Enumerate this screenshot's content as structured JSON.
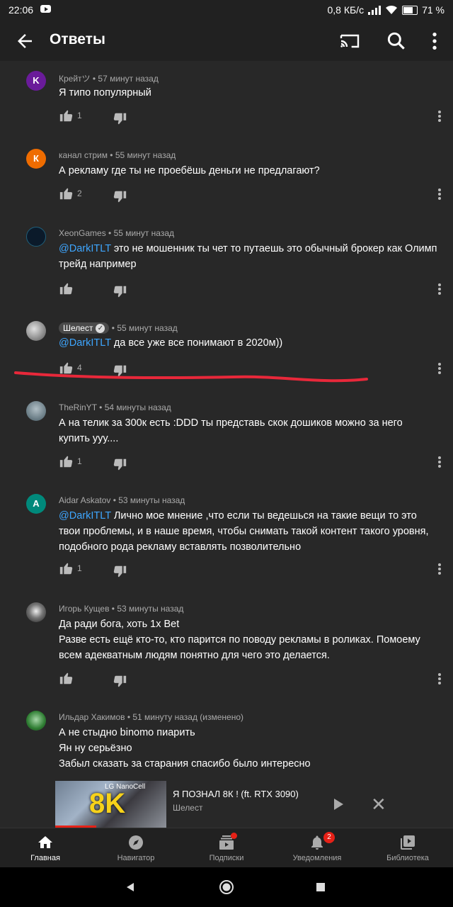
{
  "status_bar": {
    "time": "22:06",
    "net_speed": "0,8 КБ/с",
    "battery": "71 %"
  },
  "app_bar": {
    "title": "Ответы",
    "icons": [
      "back-arrow-icon",
      "cast-icon",
      "search-icon",
      "more-vert-icon"
    ]
  },
  "comments": [
    {
      "author": "Крейтツ",
      "time": "57 минут назад",
      "avatar_letter": "K",
      "avatar_color": "#6a1b9a",
      "lines": [
        "Я типо популярный"
      ],
      "likes": "1"
    },
    {
      "author": "канал стрим",
      "time": "55 минут назад",
      "avatar_letter": "К",
      "avatar_color": "#ef6c00",
      "lines": [
        "А рекламу где ты не проебёшь деньги не предлагают?"
      ],
      "likes": "2"
    },
    {
      "author": "XeonGames",
      "time": "55 минут назад",
      "avatar_color": "#0b1a2a",
      "mention": "@DarkITLT",
      "lines": [
        " это не мошенник ты чет то путаешь это обычный брокер как Олимп",
        "трейд например"
      ],
      "likes": ""
    },
    {
      "author": "Шелест",
      "time": "55 минут назад",
      "avatar_color": "#8d8d8d",
      "mention": "@DarkITLT",
      "lines": [
        " да все уже все понимают в 2020м))"
      ],
      "likes": "4"
    },
    {
      "author": "TheRinYT",
      "time": "54 минуты назад",
      "avatar_color": "#607d8b",
      "lines": [
        "А на телик за 300к есть :DDD ты представь скок дошиков можно за него",
        "купить ууу...."
      ],
      "likes": "1"
    },
    {
      "author": "Aidar Askatov",
      "time": "53 минуты назад",
      "avatar_letter": "A",
      "avatar_color": "#00897b",
      "mention": "@DarkITLT",
      "lines": [
        " Лично мое мнение ,что если ты ведешься на такие вещи то это",
        "твои проблемы, и в наше время, чтобы снимать такой контент такого уровня,",
        "подобного рода рекламу вставлять позволительно"
      ],
      "likes": "1"
    },
    {
      "author": "Игорь Кущев",
      "time": "53 минуты назад",
      "avatar_color": "#9e9e9e",
      "lines": [
        "Да ради бога, хоть 1х Bet",
        "Разве есть ещё кто-то, кто парится по поводу рекламы в роликах. Помоему",
        "всем адекватным людям понятно для чего это делается."
      ],
      "likes": ""
    },
    {
      "author": "Ильдар Хакимов",
      "time": "51 минуту назад (изменено)",
      "avatar_color": "#2e7d32",
      "lines": [
        "А не стыдно binomo пиарить",
        "Ян ну серьёзно",
        "Забыл сказать за старания спасибо было интересно"
      ],
      "likes": ""
    }
  ],
  "mini_player": {
    "title": "Я ПОЗНАЛ 8К ! (ft. RTX 3090)",
    "channel": "Шелест",
    "thumb_brand": "LG NanoCell",
    "thumb_text": "8K",
    "progress": 0.37
  },
  "bottom_nav": [
    {
      "label": "Главная",
      "icon": "home-icon",
      "active": true
    },
    {
      "label": "Навигатор",
      "icon": "explore-icon"
    },
    {
      "label": "Подписки",
      "icon": "subscriptions-icon",
      "dot": true
    },
    {
      "label": "Уведомления",
      "icon": "bell-icon",
      "badge": "2"
    },
    {
      "label": "Библиотека",
      "icon": "library-icon"
    }
  ],
  "colors": {
    "background": "#282828",
    "bar": "#212121",
    "mention": "#3ea6ff",
    "accent_red": "#e62117",
    "annotation_red": "#e8283a"
  }
}
